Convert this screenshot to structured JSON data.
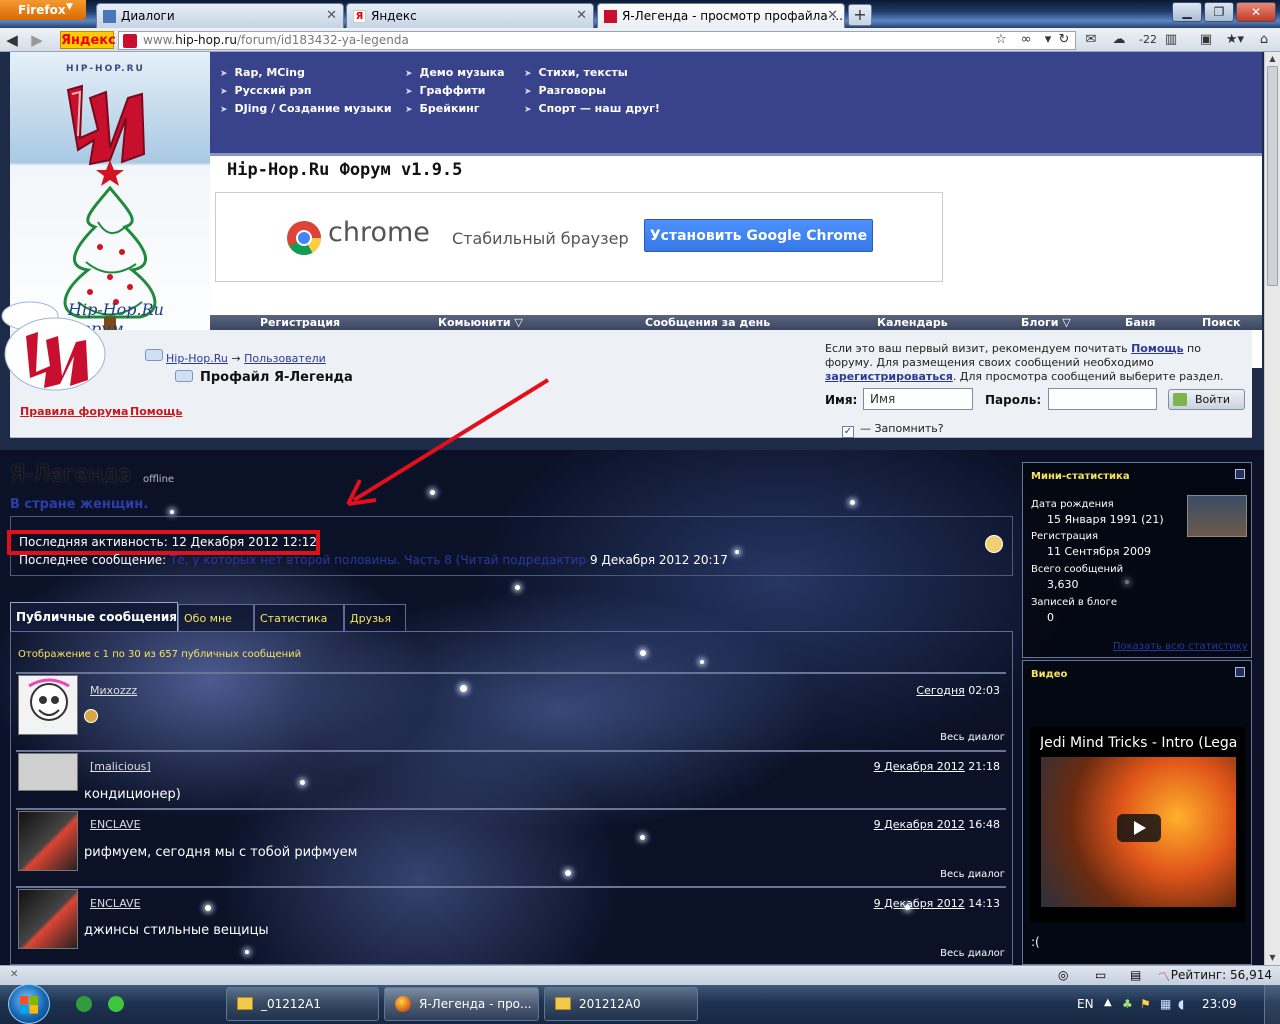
{
  "browser": {
    "menu_button": "Firefox",
    "tabs": [
      {
        "title": "Диалоги"
      },
      {
        "title": "Яндекс"
      },
      {
        "title": "Я-Легенда - просмотр профайла ..."
      }
    ],
    "yandex_label": "Яндекс",
    "url_prefix": "www.",
    "url_host": "hip-hop.ru",
    "url_path": "/forum/id183432-ya-legenda",
    "weather": "-22"
  },
  "site": {
    "logo_text": "HIP-HOP.RU",
    "forum_name": "Hip-Hop.Ru Форум",
    "title": "Hip-Hop.Ru Форум v1.9.5",
    "top_links": [
      "Rap, MCing",
      "Русский рэп",
      "DJing / Создание музыки",
      "Демо музыка",
      "Граффити",
      "Брейкинг",
      "Стихи, тексты",
      "Разговоры",
      "Спорт — наш друг!"
    ],
    "ad": {
      "brand": "chrome",
      "tagline": "Стабильный браузер",
      "button": "Установить Google Chrome"
    },
    "menu": [
      "Регистрация",
      "Комьюнити",
      "Сообщения за день",
      "Календарь",
      "Блоги",
      "Баня",
      "Поиск"
    ],
    "breadcrumb": {
      "root": "Hip-Hop.Ru",
      "sep": "→",
      "section": "Пользователи"
    },
    "page_title": "Профайл Я-Легенда",
    "rules_link": "Правила форума",
    "help_link": "Помощь",
    "notice": {
      "part1": "Если это ваш первый визит, рекомендуем почитать ",
      "link1": "Помощь",
      "part2": " по форуму. Для размещения своих сообщений необходимо ",
      "link2": "зарегистрироваться",
      "part3": ". Для просмотра сообщений выберите раздел."
    },
    "login": {
      "name_label": "Имя:",
      "name_value": "Имя",
      "pass_label": "Пароль:",
      "button": "Войти",
      "remember": "— Запомнить?"
    }
  },
  "profile": {
    "username": "Я-Легенда",
    "online_state": "offline",
    "status_text": "В стране женщин.",
    "last_activity_label": "Последняя активность:",
    "last_activity_value": "12 Декабря 2012 12:12",
    "last_message_label": "Последнее сообщение:",
    "last_message_link": "Те, у которых нет второй половины. Часть 8 (Читай подредактир",
    "last_message_date": "9 Декабря 2012 20:17",
    "tabs": [
      "Публичные сообщения",
      "Обо мне",
      "Статистика",
      "Друзья"
    ],
    "wall_count": "Отображение с 1 по 30 из 657 публичных сообщений",
    "messages": [
      {
        "author": "Михоzzz",
        "date": "Сегодня",
        "time": "02:03",
        "text": "",
        "dialog": "Весь диалог"
      },
      {
        "author": "[malicious]",
        "date": "9 Декабря 2012",
        "time": "21:18",
        "text": "кондиционер)",
        "dialog": ""
      },
      {
        "author": "ENCLAVE",
        "date": "9 Декабря 2012",
        "time": "16:48",
        "text": "рифмуем, сегодня мы с тобой рифмуем",
        "dialog": "Весь диалог"
      },
      {
        "author": "ENCLAVE",
        "date": "9 Декабря 2012",
        "time": "14:13",
        "text": "джинсы стильные вещицы",
        "dialog": "Весь диалог"
      }
    ]
  },
  "sidebar": {
    "stats_title": "Мини-статистика",
    "birth_label": "Дата рождения",
    "birth_value": "15 Января 1991 (21)",
    "reg_label": "Регистрация",
    "reg_value": "11 Сентября 2009",
    "posts_label": "Всего сообщений",
    "posts_value": "3,630",
    "blog_label": "Записей в блоге",
    "blog_value": "0",
    "show_all": "Показать всю статистику",
    "video_title": "Видео",
    "video_name": "Jedi Mind Tricks - Intro (Lega",
    "video_caption": ":("
  },
  "statusbar": {
    "rating": "Рейтинг: 56,914"
  },
  "taskbar": {
    "items": [
      "_01212A1",
      "Я-Легенда - про...",
      "201212A0"
    ],
    "lang": "EN",
    "clock": "23:09"
  },
  "colors": {
    "accent_red": "#e2101a",
    "nav_blue": "#38438b",
    "yellow_text": "#f5e55b",
    "link_blue": "#2638a0"
  }
}
